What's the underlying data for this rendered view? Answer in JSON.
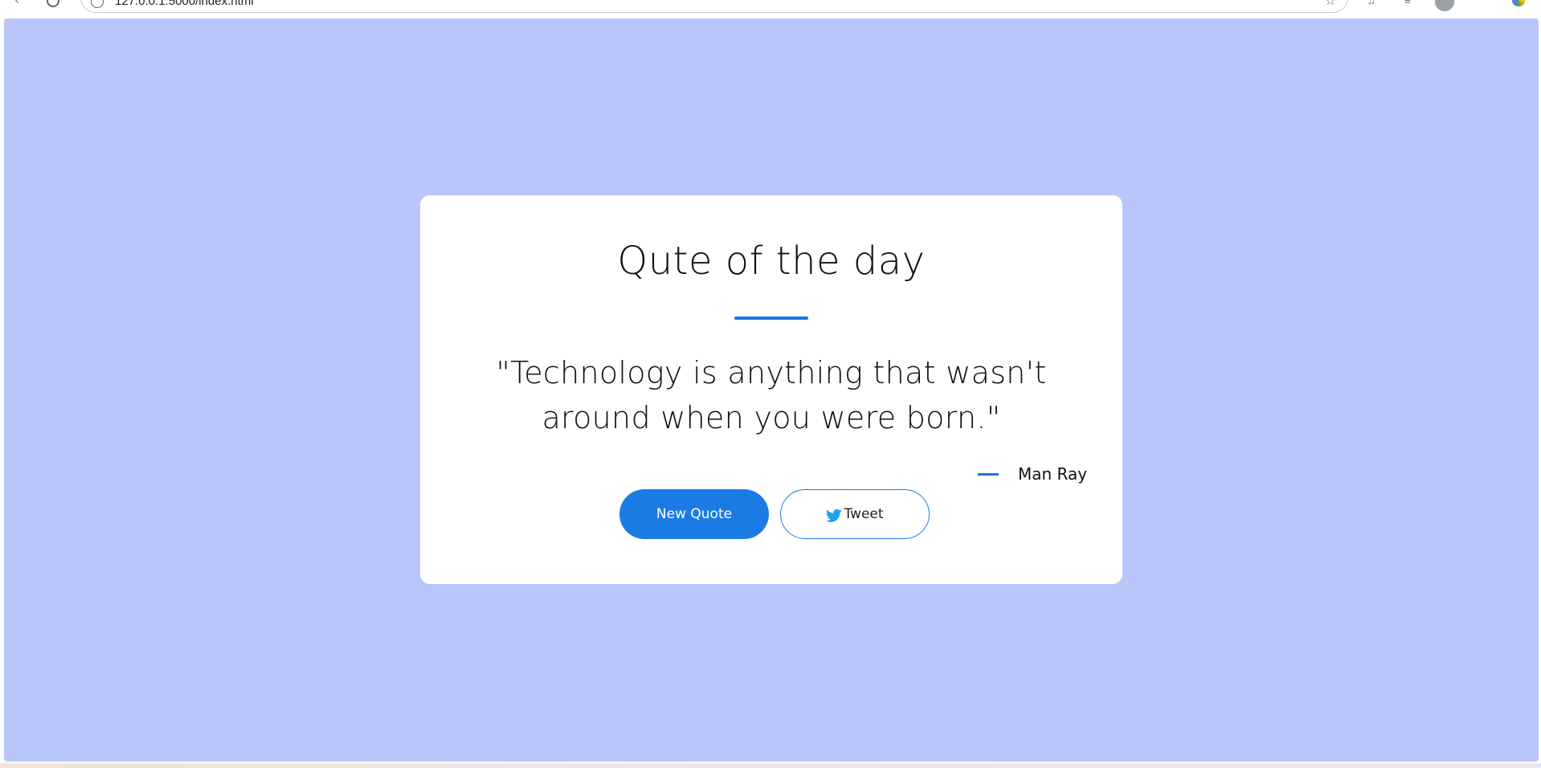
{
  "browser": {
    "url": "127.0.0.1:5000/index.html",
    "star_icon": "star-icon",
    "back_icon": "back-arrow-icon",
    "reload_icon": "reload-icon"
  },
  "colors": {
    "page_background": "#bac6f9",
    "card_background": "#ffffff",
    "accent": "#1a7be5",
    "text": "#111111"
  },
  "card": {
    "title": "Qute of the day",
    "quote": "\"Technology is anything that wasn't around when you were born.\"",
    "author": "Man Ray",
    "new_quote_label": "New Quote",
    "tweet_label": "Tweet",
    "tweet_icon": "twitter-icon"
  }
}
